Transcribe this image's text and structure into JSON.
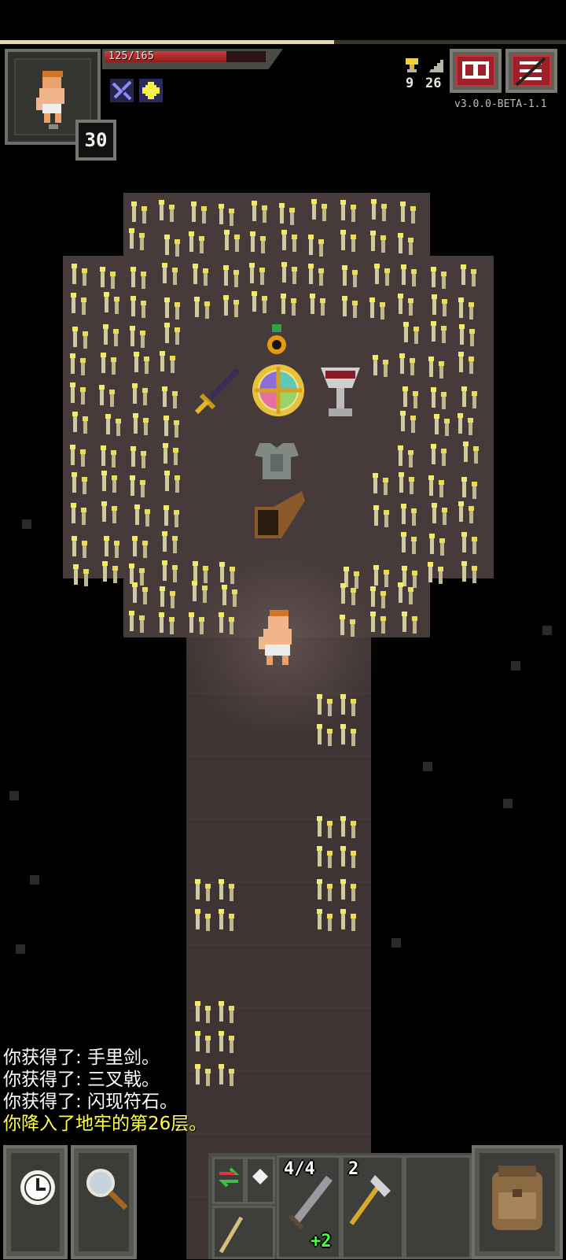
{
  "hud": {
    "xp_progress": 0.59,
    "hp_text": "125/165",
    "hp_current": 125,
    "hp_max": 165,
    "hero_level": "30",
    "buffs": [
      "mind-vision-icon",
      "light-icon"
    ],
    "challenges_count": "9",
    "depth": "26",
    "version": "v3.0.0-BETA-1.1",
    "buttons": [
      "journal-icon",
      "menu-icon"
    ]
  },
  "dungeon": {
    "items": [
      "ring",
      "sword",
      "artifact-wheel",
      "chalice",
      "armor",
      "horn"
    ],
    "floor_color": "#463a3a"
  },
  "log": {
    "lines": [
      "你获得了: 手里剑。",
      "你获得了: 三叉戟。",
      "你获得了: 闪现符石。",
      "你降入了地牢的第26层。"
    ],
    "highlight_color": "#ffff44"
  },
  "toolbar": {
    "wait_icon": "clock-icon",
    "search_icon": "magnifier-icon",
    "quickslots": {
      "sword_charges": "4/4",
      "sword_upgrade": "+2",
      "axe_count": "2"
    },
    "backpack_icon": "backpack-icon"
  }
}
